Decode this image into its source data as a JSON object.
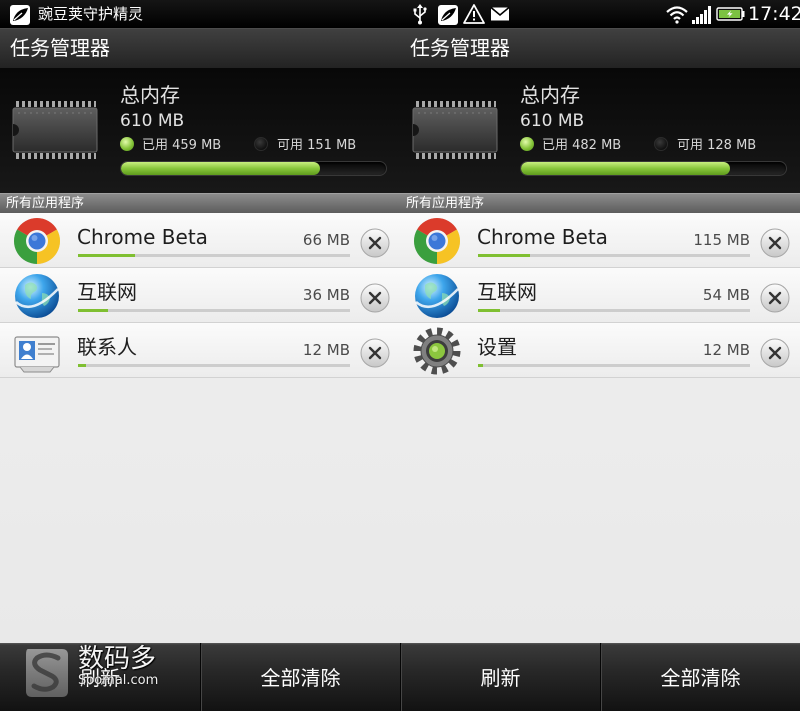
{
  "status_bar": {
    "app_icon": "pea-leaf-icon",
    "app_name": "豌豆荚守护精灵",
    "notification_icons": [
      "usb-icon",
      "pea-leaf-icon",
      "warning-icon",
      "mail-icon"
    ],
    "system_icons": [
      "wifi-icon",
      "signal-icon",
      "battery-icon"
    ],
    "time": "17:42"
  },
  "panels": [
    {
      "title": "任务管理器",
      "memory": {
        "icon": "memory-chip-icon",
        "label": "总内存",
        "total": "610 MB",
        "used_label": "已用 459 MB",
        "free_label": "可用 151 MB",
        "usage_fraction": 0.75
      },
      "section_label": "所有应用程序",
      "apps": [
        {
          "name": "Chrome Beta",
          "size": "66 MB",
          "icon": "chrome-icon",
          "bar_fraction": 0.21
        },
        {
          "name": "互联网",
          "size": "36 MB",
          "icon": "globe-icon",
          "bar_fraction": 0.11
        },
        {
          "name": "联系人",
          "size": "12 MB",
          "icon": "contacts-icon",
          "bar_fraction": 0.03
        }
      ]
    },
    {
      "title": "任务管理器",
      "memory": {
        "icon": "memory-chip-icon",
        "label": "总内存",
        "total": "610 MB",
        "used_label": "已用 482 MB",
        "free_label": "可用 128 MB",
        "usage_fraction": 0.79
      },
      "section_label": "所有应用程序",
      "apps": [
        {
          "name": "Chrome Beta",
          "size": "115 MB",
          "icon": "chrome-icon",
          "bar_fraction": 0.19
        },
        {
          "name": "互联网",
          "size": "54 MB",
          "icon": "globe-icon",
          "bar_fraction": 0.08
        },
        {
          "name": "设置",
          "size": "12 MB",
          "icon": "settings-gear-icon",
          "bar_fraction": 0.02
        }
      ]
    }
  ],
  "bottom_bar": {
    "buttons": [
      "刷新",
      "全部清除",
      "刷新",
      "全部清除"
    ]
  },
  "watermark": {
    "brand": "数码多",
    "site": "Soomal.com"
  },
  "colors": {
    "accent_green": "#7fbf31",
    "status_bar_bg": "#000000",
    "list_bg": "#eeeeee",
    "text_dark": "#1e1e1e"
  }
}
